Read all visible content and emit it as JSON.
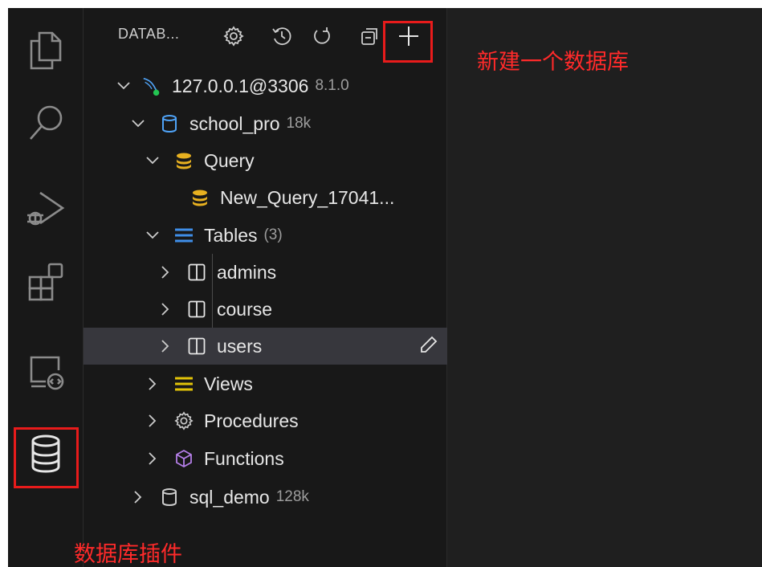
{
  "activity_bar": {
    "items": [
      {
        "icon": "explorer-icon"
      },
      {
        "icon": "search-icon"
      },
      {
        "icon": "run-debug-icon"
      },
      {
        "icon": "extensions-icon"
      },
      {
        "icon": "remote-explorer-icon"
      },
      {
        "icon": "database-icon"
      }
    ]
  },
  "sidebar": {
    "title": "DATAB...",
    "toolbar": [
      "settings-icon",
      "history-icon",
      "refresh-icon",
      "collapse-all-icon",
      "add-icon"
    ]
  },
  "tree": {
    "connection": {
      "label": "127.0.0.1@3306",
      "version": "8.1.0"
    },
    "db1": {
      "label": "school_pro",
      "size": "18k"
    },
    "query": {
      "label": "Query"
    },
    "new_query": {
      "label": "New_Query_17041..."
    },
    "tables": {
      "label": "Tables",
      "count": "(3)"
    },
    "table_admins": {
      "label": "admins"
    },
    "table_course": {
      "label": "course"
    },
    "table_users": {
      "label": "users"
    },
    "views": {
      "label": "Views"
    },
    "procedures": {
      "label": "Procedures"
    },
    "functions": {
      "label": "Functions"
    },
    "db2": {
      "label": "sql_demo",
      "size": "128k"
    }
  },
  "annotations": {
    "new_db": "新建一个数据库",
    "plugin": "数据库插件"
  },
  "colors": {
    "annotation": "#e81b1b",
    "query_icon": "#e8b120",
    "tables_icon": "#3f8ee8",
    "views_icon": "#e2c308",
    "functions_icon": "#b57fe8",
    "db_icon": "#4fa3f7",
    "status_green": "#23c552"
  }
}
